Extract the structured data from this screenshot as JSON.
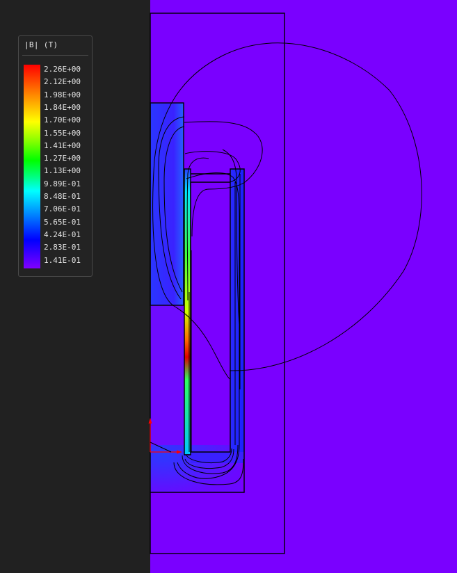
{
  "legend": {
    "title": "|B| (T)",
    "labels": [
      "2.26E+00",
      "2.12E+00",
      "1.98E+00",
      "1.84E+00",
      "1.70E+00",
      "1.55E+00",
      "1.41E+00",
      "1.27E+00",
      "1.13E+00",
      "9.89E-01",
      "8.48E-01",
      "7.06E-01",
      "5.65E-01",
      "4.24E-01",
      "2.83E-01",
      "1.41E-01"
    ]
  },
  "colors": {
    "background": "#212121",
    "field_low": "#7a00ff",
    "field_mid": "#3a1cff",
    "field_high": "#ff0000",
    "outline": "#000000",
    "axis": "#ff0000"
  }
}
